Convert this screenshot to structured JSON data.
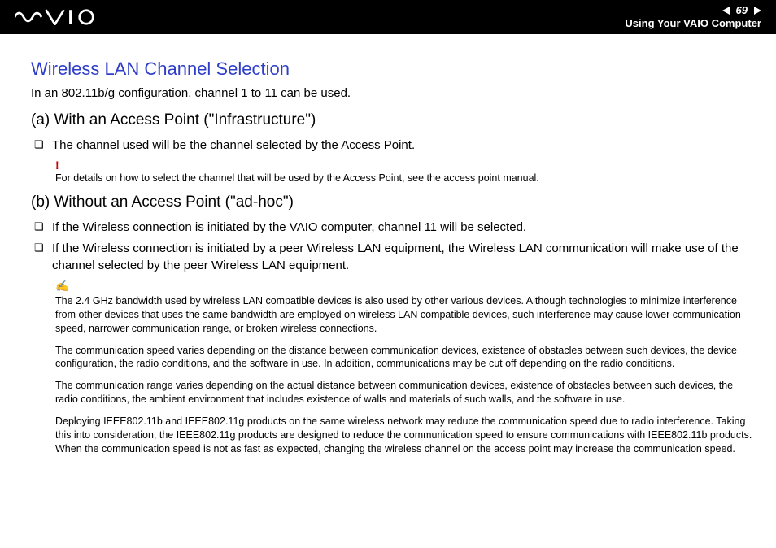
{
  "header": {
    "page_number": "69",
    "subtitle": "Using Your VAIO Computer"
  },
  "title": "Wireless LAN Channel Selection",
  "intro": "In an 802.11b/g configuration, channel 1 to 11 can be used.",
  "section_a": {
    "heading": "(a) With an Access Point (\"Infrastructure\")",
    "bullets": [
      "The channel used will be the channel selected by the Access Point."
    ],
    "warning": "For details on how to select the channel that will be used by the Access Point, see the access point manual."
  },
  "section_b": {
    "heading": "(b) Without an Access Point (\"ad-hoc\")",
    "bullets": [
      "If the Wireless connection is initiated by the VAIO computer, channel 11 will be selected.",
      "If the Wireless connection is initiated by a peer Wireless LAN equipment, the Wireless LAN communication will make use of the channel selected by the peer Wireless LAN equipment."
    ],
    "notes": [
      "The 2.4 GHz bandwidth used by wireless LAN compatible devices is also used by other various devices. Although technologies to minimize interference from other devices that uses the same bandwidth are employed on wireless LAN compatible devices, such interference may cause lower communication speed, narrower communication range, or broken wireless connections.",
      "The communication speed varies depending on the distance between communication devices, existence of obstacles between such devices, the device configuration, the radio conditions, and the software in use. In addition, communications may be cut off depending on the radio conditions.",
      "The communication range varies depending on the actual distance between communication devices, existence of obstacles between such devices, the radio conditions, the ambient environment that includes existence of walls and materials of such walls, and the software in use.",
      "Deploying IEEE802.11b and IEEE802.11g products on the same wireless network may reduce the communication speed due to radio interference. Taking this into consideration, the IEEE802.11g products are designed to reduce the communication speed to ensure communications with IEEE802.11b products.\nWhen the communication speed is not as fast as expected, changing the wireless channel on the access point may increase the communication speed."
    ]
  }
}
